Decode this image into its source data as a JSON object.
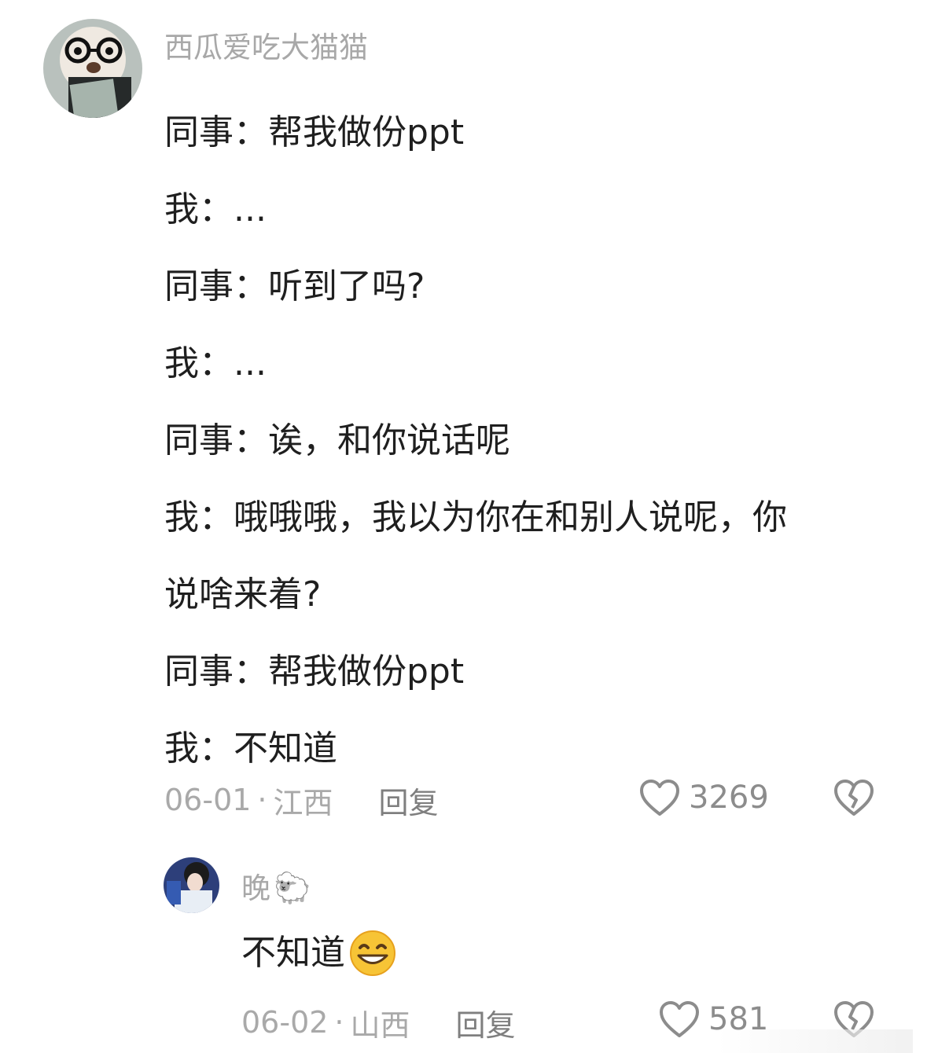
{
  "main_comment": {
    "username": "西瓜爱吃大猫猫",
    "lines": [
      "同事：帮我做份ppt",
      "我：...",
      "同事：听到了吗?",
      "我：...",
      "同事：诶，和你说话呢",
      "我：哦哦哦，我以为你在和别人说呢，你",
      "说啥来着?",
      "同事：帮我做份ppt",
      "我：不知道"
    ],
    "date": "06-01",
    "separator": "·",
    "location": "江西",
    "reply_label": "回复",
    "likes": "3269"
  },
  "reply_comment": {
    "username": "晚",
    "username_emoji": "🐑",
    "text": "不知道",
    "date": "06-02",
    "separator": "·",
    "location": "山西",
    "reply_label": "回复",
    "likes": "581"
  },
  "icons": {
    "like": "heart-outline-icon",
    "dislike": "broken-heart-icon",
    "reply_emoji": "grinning-face-icon"
  },
  "colors": {
    "text": "#1f1f1f",
    "meta": "#a9a9a9",
    "icon": "#8c8c8c"
  }
}
